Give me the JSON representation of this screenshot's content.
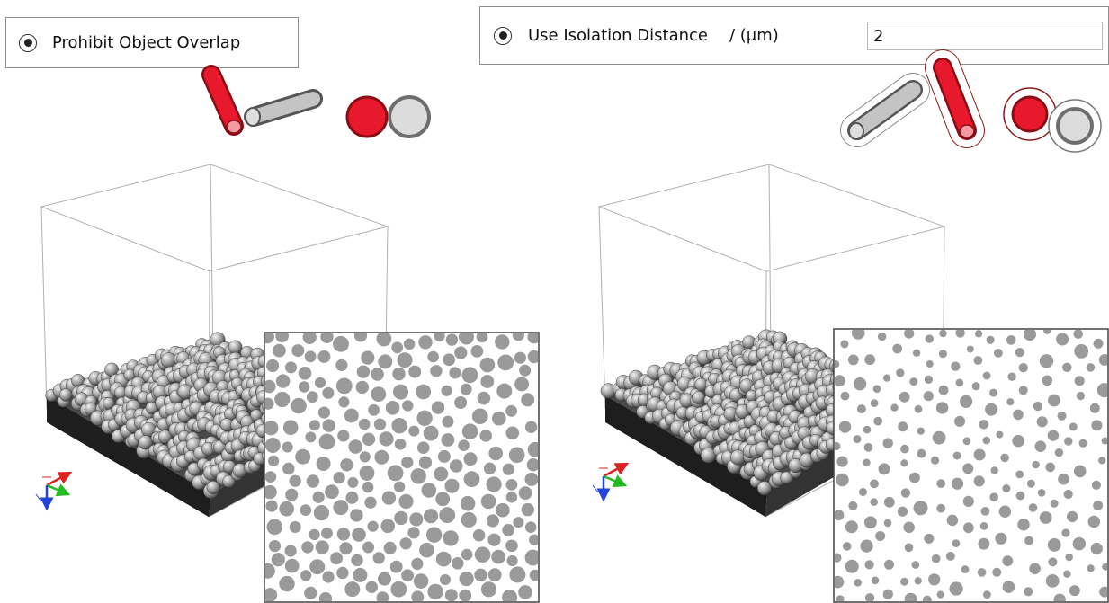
{
  "prohibit_overlap": {
    "label": "Prohibit Object Overlap",
    "selected": true
  },
  "isolation_distance": {
    "label": "Use Isolation Distance",
    "unit": "/ (µm)",
    "value": "2",
    "selected": true
  },
  "colors": {
    "active_object": "#e8192c",
    "neighbor_object": "#c4c4c4",
    "isolation_shell": "#8b1a1a",
    "particle": "#9a9a9a",
    "axis_x": "#dd2222",
    "axis_y": "#22bb22",
    "axis_z": "#2244dd"
  },
  "icons": [
    "radio-button-icon",
    "fiber-icon",
    "sphere-icon",
    "orientation-axes-icon"
  ]
}
